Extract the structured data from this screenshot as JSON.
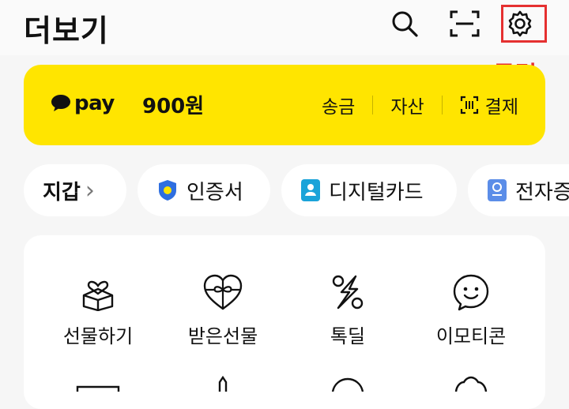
{
  "header": {
    "title": "더보기",
    "annotation": "클릭"
  },
  "pay": {
    "brand": "pay",
    "amount": "900원",
    "actions": [
      "송금",
      "자산",
      "결제"
    ]
  },
  "chips": [
    {
      "label": "지갑",
      "chevron": "›"
    },
    {
      "label": "인증서"
    },
    {
      "label": "디지털카드"
    },
    {
      "label": "전자증"
    }
  ],
  "grid": [
    {
      "label": "선물하기",
      "icon": "gift-box-icon"
    },
    {
      "label": "받은선물",
      "icon": "gift-heart-icon"
    },
    {
      "label": "톡딜",
      "icon": "percent-bolt-icon"
    },
    {
      "label": "이모티콘",
      "icon": "smile-icon"
    }
  ],
  "colors": {
    "pay_yellow": "#ffe500",
    "annotation_red": "#e53030",
    "cert_blue": "#2f6fe0",
    "card_cyan": "#1aa3d9",
    "doc_blue": "#5b8de8"
  }
}
